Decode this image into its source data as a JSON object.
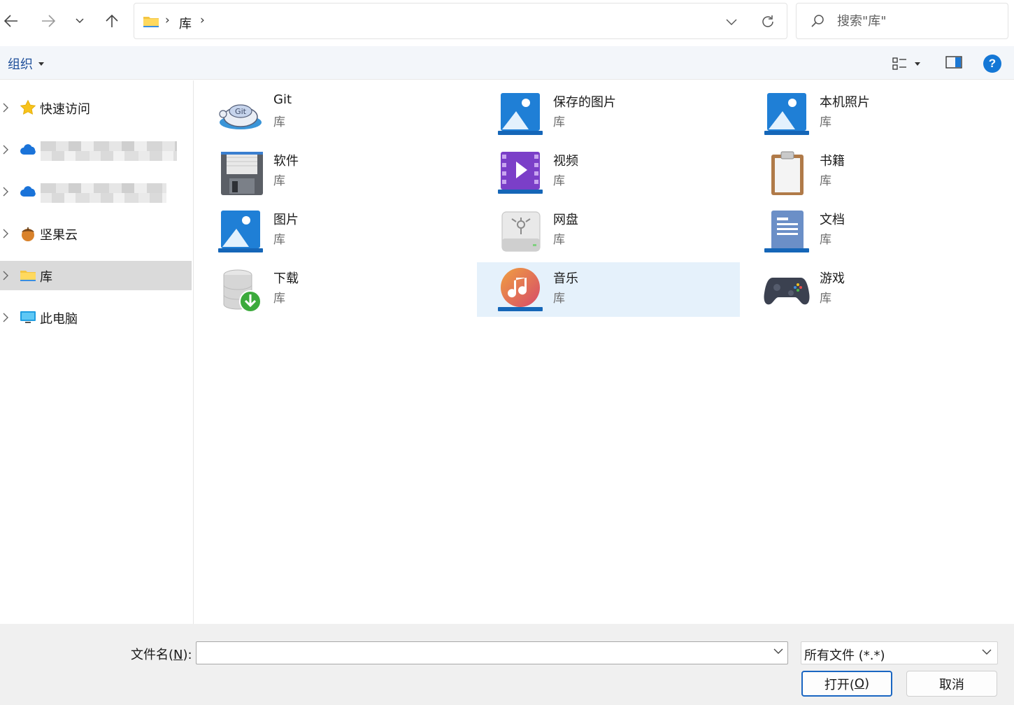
{
  "address": {
    "breadcrumb": "库",
    "search_placeholder": "搜索\"库\""
  },
  "toolbar": {
    "organize_label": "组织",
    "help_label": "?"
  },
  "sidebar": {
    "items": [
      {
        "label": "快速访问",
        "icon": "star-icon"
      },
      {
        "label": "",
        "icon": "onedrive-cloud-icon",
        "blurred": true
      },
      {
        "label": "",
        "icon": "onedrive-cloud-icon",
        "blurred": true
      },
      {
        "label": "坚果云",
        "icon": "nutstore-icon"
      },
      {
        "label": "库",
        "icon": "folder-icon",
        "selected": true
      },
      {
        "label": "此电脑",
        "icon": "computer-icon"
      }
    ]
  },
  "libraries": [
    {
      "name": "Git",
      "type": "库",
      "icon": "git-turtle-icon"
    },
    {
      "name": "保存的图片",
      "type": "库",
      "icon": "picture-icon"
    },
    {
      "name": "本机照片",
      "type": "库",
      "icon": "picture-icon"
    },
    {
      "name": "软件",
      "type": "库",
      "icon": "floppy-disk-icon"
    },
    {
      "name": "视频",
      "type": "库",
      "icon": "video-icon"
    },
    {
      "name": "书籍",
      "type": "库",
      "icon": "clipboard-icon"
    },
    {
      "name": "图片",
      "type": "库",
      "icon": "picture-icon"
    },
    {
      "name": "网盘",
      "type": "库",
      "icon": "drive-icon"
    },
    {
      "name": "文档",
      "type": "库",
      "icon": "document-icon"
    },
    {
      "name": "下载",
      "type": "库",
      "icon": "download-icon"
    },
    {
      "name": "音乐",
      "type": "库",
      "icon": "music-icon",
      "selected": true
    },
    {
      "name": "游戏",
      "type": "库",
      "icon": "gamepad-icon"
    }
  ],
  "footer": {
    "filename_label_prefix": "文件名(",
    "filename_label_key": "N",
    "filename_label_suffix": "):",
    "filename_value": "",
    "filetype_value": "所有文件 (*.*)",
    "open_label_prefix": "打开(",
    "open_label_key": "O",
    "open_label_suffix": ")",
    "cancel_label": "取消"
  }
}
